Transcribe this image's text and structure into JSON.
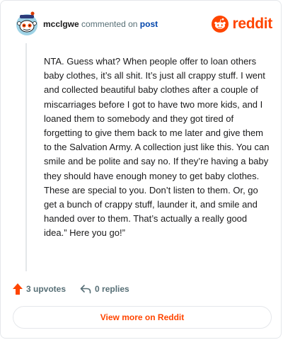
{
  "header": {
    "username": "mcclgwe",
    "commented_on": "commented on",
    "post_link": "post",
    "brand": "reddit"
  },
  "comment": {
    "text": "NTA. Guess what? When people offer to loan others baby clothes, it’s all shit. It’s just all crappy stuff. I went and collected beautiful baby clothes after a couple of miscarriages before I got to have two more kids, and I loaned them to somebody and they got tired of forgetting to give them back to me later and give them to the Salvation Army. A collection just like this. You can smile and be polite and say no. If they’re having a baby they should have enough money to get baby clothes. These are special to you. Don’t listen to them. Or, go get a bunch of crappy stuff, launder it, and smile and handed over to them. That’s actually a really good idea.” Here you go!”"
  },
  "actions": {
    "upvotes": "3 upvotes",
    "replies": "0 replies"
  },
  "footer": {
    "view_more": "View more on Reddit"
  },
  "colors": {
    "accent": "#ff4500",
    "link": "#0045ac",
    "muted": "#576f76"
  },
  "icons": [
    "avatar-snoo",
    "reddit-logo-icon",
    "upvote-arrow-icon",
    "reply-icon"
  ]
}
